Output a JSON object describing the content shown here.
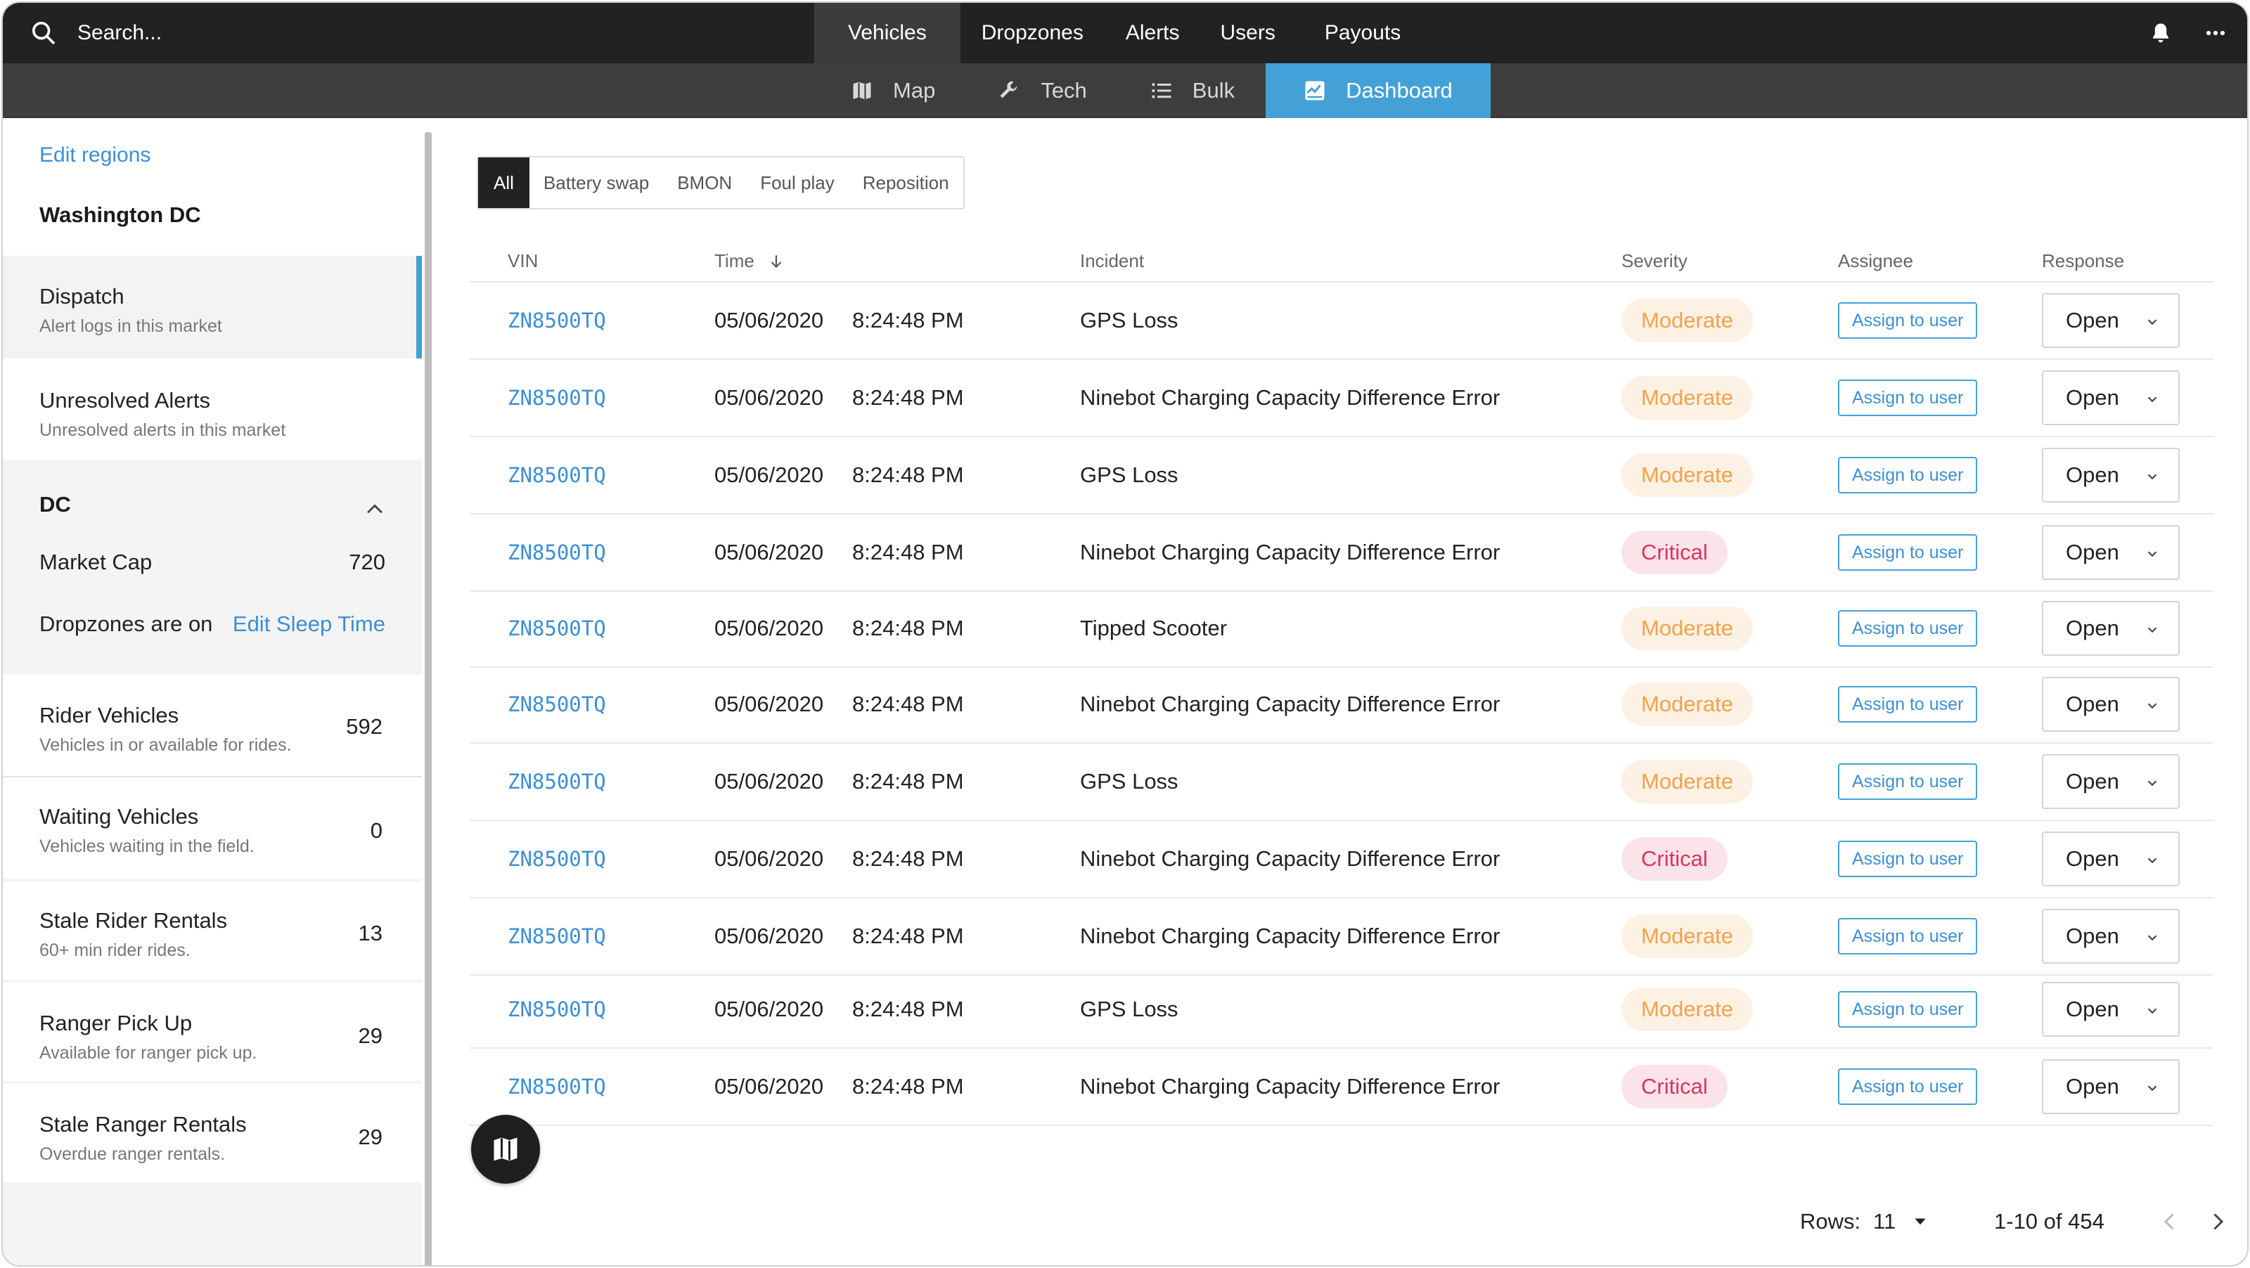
{
  "topbar": {
    "search_placeholder": "Search...",
    "nav": [
      "Vehicles",
      "Dropzones",
      "Alerts",
      "Users",
      "Payouts"
    ],
    "active_nav": "Vehicles"
  },
  "subnav": {
    "items": [
      {
        "label": "Map",
        "icon": "map-icon"
      },
      {
        "label": "Tech",
        "icon": "wrench-icon"
      },
      {
        "label": "Bulk",
        "icon": "list-icon"
      },
      {
        "label": "Dashboard",
        "icon": "dashboard-icon"
      }
    ],
    "active": "Dashboard"
  },
  "sidebar": {
    "edit_regions": "Edit regions",
    "region": "Washington DC",
    "dispatch": {
      "title": "Dispatch",
      "subtitle": "Alert logs in this market"
    },
    "unresolved": {
      "title": "Unresolved Alerts",
      "subtitle": "Unresolved alerts in this market"
    },
    "dc": {
      "title": "DC",
      "market_cap_label": "Market Cap",
      "market_cap_value": "720",
      "dropzones_label": "Dropzones are on",
      "edit_sleep_time": "Edit Sleep Time"
    },
    "stats": [
      {
        "title": "Rider Vehicles",
        "subtitle": "Vehicles in or available for rides.",
        "value": "592"
      },
      {
        "title": "Waiting Vehicles",
        "subtitle": "Vehicles waiting in the field.",
        "value": "0"
      },
      {
        "title": "Stale Rider Rentals",
        "subtitle": "60+ min rider rides.",
        "value": "13"
      },
      {
        "title": "Ranger Pick Up",
        "subtitle": "Available for ranger pick up.",
        "value": "29"
      },
      {
        "title": "Stale Ranger Rentals",
        "subtitle": "Overdue ranger rentals.",
        "value": "29"
      }
    ]
  },
  "filters": [
    "All",
    "Battery swap",
    "BMON",
    "Foul play",
    "Reposition"
  ],
  "active_filter": "All",
  "table": {
    "headers": {
      "vin": "VIN",
      "time": "Time",
      "incident": "Incident",
      "severity": "Severity",
      "assignee": "Assignee",
      "response": "Response"
    },
    "assign_label": "Assign to user",
    "rows": [
      {
        "vin": "ZN8500TQ",
        "date": "05/06/2020",
        "time": "8:24:48 PM",
        "incident": "GPS Loss",
        "severity": "Moderate",
        "response": "Open"
      },
      {
        "vin": "ZN8500TQ",
        "date": "05/06/2020",
        "time": "8:24:48 PM",
        "incident": "Ninebot Charging Capacity Difference Error",
        "severity": "Moderate",
        "response": "Open"
      },
      {
        "vin": "ZN8500TQ",
        "date": "05/06/2020",
        "time": "8:24:48 PM",
        "incident": "GPS Loss",
        "severity": "Moderate",
        "response": "Open"
      },
      {
        "vin": "ZN8500TQ",
        "date": "05/06/2020",
        "time": "8:24:48 PM",
        "incident": "Ninebot Charging Capacity Difference Error",
        "severity": "Critical",
        "response": "Open"
      },
      {
        "vin": "ZN8500TQ",
        "date": "05/06/2020",
        "time": "8:24:48 PM",
        "incident": "Tipped Scooter",
        "severity": "Moderate",
        "response": "Open"
      },
      {
        "vin": "ZN8500TQ",
        "date": "05/06/2020",
        "time": "8:24:48 PM",
        "incident": "Ninebot Charging Capacity Difference Error",
        "severity": "Moderate",
        "response": "Open"
      },
      {
        "vin": "ZN8500TQ",
        "date": "05/06/2020",
        "time": "8:24:48 PM",
        "incident": "GPS Loss",
        "severity": "Moderate",
        "response": "Open"
      },
      {
        "vin": "ZN8500TQ",
        "date": "05/06/2020",
        "time": "8:24:48 PM",
        "incident": "Ninebot Charging Capacity Difference Error",
        "severity": "Critical",
        "response": "Open"
      },
      {
        "vin": "ZN8500TQ",
        "date": "05/06/2020",
        "time": "8:24:48 PM",
        "incident": "Ninebot Charging Capacity Difference Error",
        "severity": "Moderate",
        "response": "Open"
      },
      {
        "vin": "ZN8500TQ",
        "date": "05/06/2020",
        "time": "8:24:48 PM",
        "incident": "GPS Loss",
        "severity": "Moderate",
        "response": "Open"
      },
      {
        "vin": "ZN8500TQ",
        "date": "05/06/2020",
        "time": "8:24:48 PM",
        "incident": "Ninebot Charging Capacity Difference Error",
        "severity": "Critical",
        "response": "Open"
      }
    ]
  },
  "pagination": {
    "rows_label": "Rows:",
    "rows_value": "11",
    "range": "1-10 of 454"
  },
  "colors": {
    "accent": "#43a1d8",
    "moderate": "#f2a24c",
    "critical": "#d8365f",
    "topbar": "#222222"
  }
}
